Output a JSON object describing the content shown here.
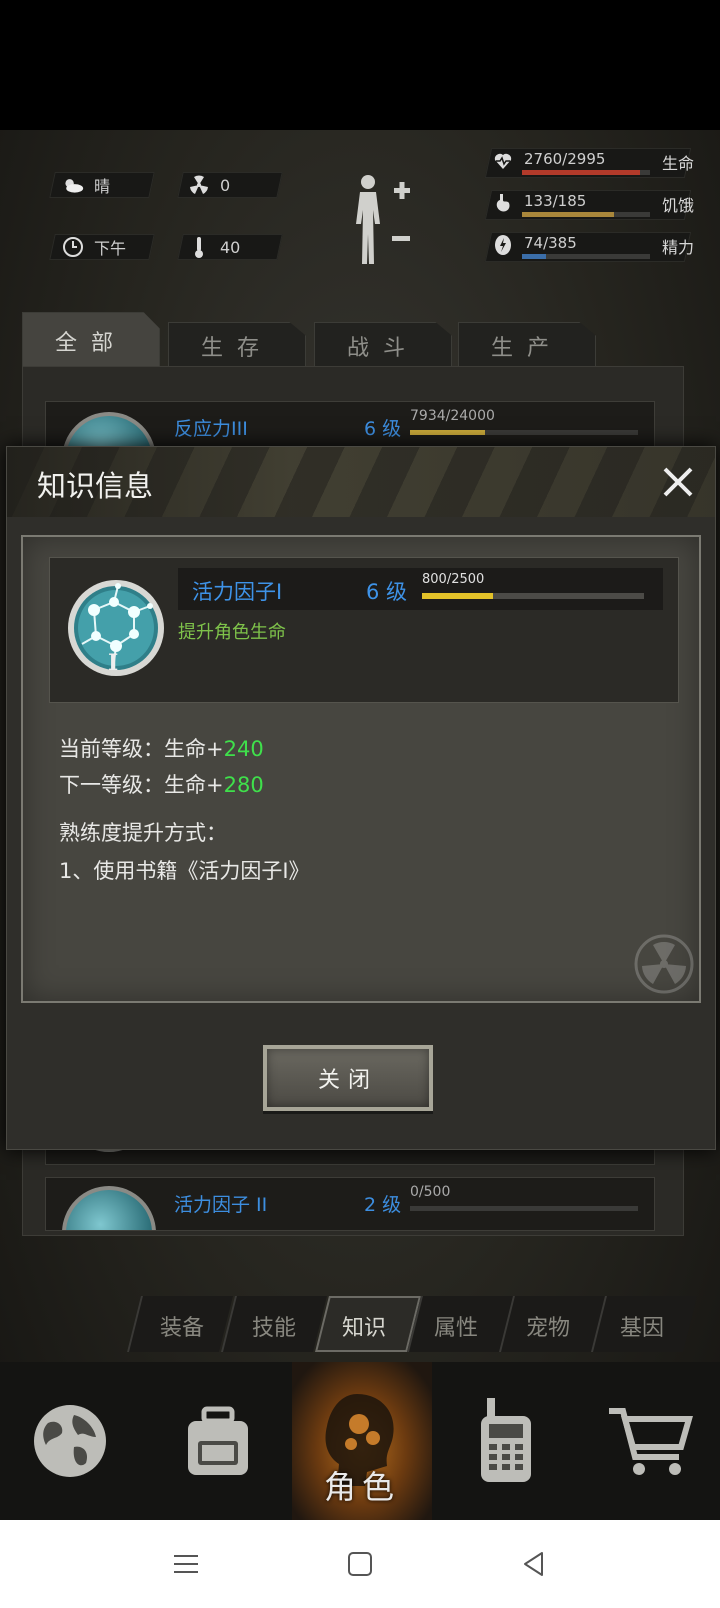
{
  "status": {
    "weather": "晴",
    "radiation": "0",
    "time": "下午",
    "temperature": "40",
    "stats": [
      {
        "value": "2760/2995",
        "name": "生命",
        "ratio": 0.92,
        "color": "#b23a2a"
      },
      {
        "value": "133/185",
        "name": "饥饿",
        "ratio": 0.72,
        "color": "#a9873b"
      },
      {
        "value": "74/385",
        "name": "精力",
        "ratio": 0.19,
        "color": "#3b6ea9"
      }
    ]
  },
  "tabs": [
    "全部",
    "生存",
    "战斗",
    "生产"
  ],
  "list": [
    {
      "name": "反应力III",
      "level": "6 级",
      "progress": "7934/24000",
      "ratio": 0.33
    },
    {
      "name": "活力因子 II",
      "level": "2 级",
      "progress": "0/500",
      "ratio": 0
    }
  ],
  "modal": {
    "title": "知识信息",
    "item_name": "活力因子Ⅰ",
    "item_level": "6 级",
    "item_progress": "800/2500",
    "item_progress_ratio": 0.32,
    "item_desc": "提升角色生命",
    "current_label": "当前等级：生命+",
    "current_value": "240",
    "next_label": "下一等级：生命+",
    "next_value": "280",
    "method_title": "熟练度提升方式：",
    "method_1": "1、使用书籍《活力因子Ⅰ》",
    "close_button": "关闭"
  },
  "subnav": [
    "装备",
    "技能",
    "知识",
    "属性",
    "宠物",
    "基因"
  ],
  "mainnav": {
    "active_label": "角色"
  }
}
